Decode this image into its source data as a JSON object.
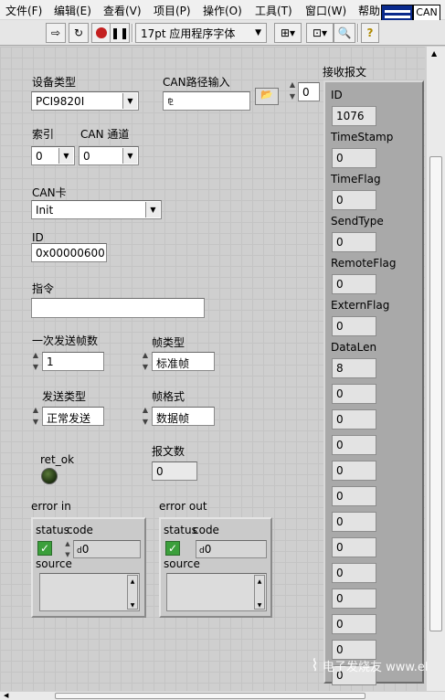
{
  "menu": [
    "文件(F)",
    "编辑(E)",
    "查看(V)",
    "项目(P)",
    "操作(O)",
    "工具(T)",
    "窗口(W)",
    "帮助"
  ],
  "toolbar": {
    "font_label": "17pt 应用程序字体",
    "can_logo": "CAN"
  },
  "device_type": {
    "label": "设备类型",
    "value": "PCI9820I"
  },
  "can_path": {
    "label": "CAN路径输入",
    "value": "",
    "spin_value": "0"
  },
  "recv_label": "接收报文",
  "index": {
    "label": "索引",
    "value": "0"
  },
  "channel": {
    "label": "CAN 通道",
    "value": "0"
  },
  "can_card": {
    "label": "CAN卡",
    "value": "Init"
  },
  "id_field": {
    "label": "ID",
    "value": "0x00000600"
  },
  "command": {
    "label": "指令",
    "value": ""
  },
  "frames_once": {
    "label": "一次发送帧数",
    "value": "1"
  },
  "frame_type": {
    "label": "帧类型",
    "value": "标准帧"
  },
  "send_type": {
    "label": "发送类型",
    "value": "正常发送"
  },
  "frame_format": {
    "label": "帧格式",
    "value": "数据帧"
  },
  "ret_ok": {
    "label": "ret_ok"
  },
  "msg_count": {
    "label": "报文数",
    "value": "0"
  },
  "error_in": {
    "title": "error in",
    "status": "status",
    "code": "code",
    "code_value": "0",
    "source": "source"
  },
  "error_out": {
    "title": "error out",
    "status": "status",
    "code": "code",
    "code_value": "0",
    "source": "source"
  },
  "recv_fields": [
    {
      "label": "ID",
      "value": "1076"
    },
    {
      "label": "TimeStamp",
      "value": "0"
    },
    {
      "label": "TimeFlag",
      "value": "0"
    },
    {
      "label": "SendType",
      "value": "0"
    },
    {
      "label": "RemoteFlag",
      "value": "0"
    },
    {
      "label": "ExternFlag",
      "value": "0"
    },
    {
      "label": "DataLen",
      "value": "8"
    }
  ],
  "data_bytes": [
    "0",
    "0",
    "0",
    "0",
    "0",
    "0",
    "0",
    "0",
    "0",
    "0",
    "0",
    "0"
  ],
  "watermark": "电子发烧友 www.elecfans.com"
}
